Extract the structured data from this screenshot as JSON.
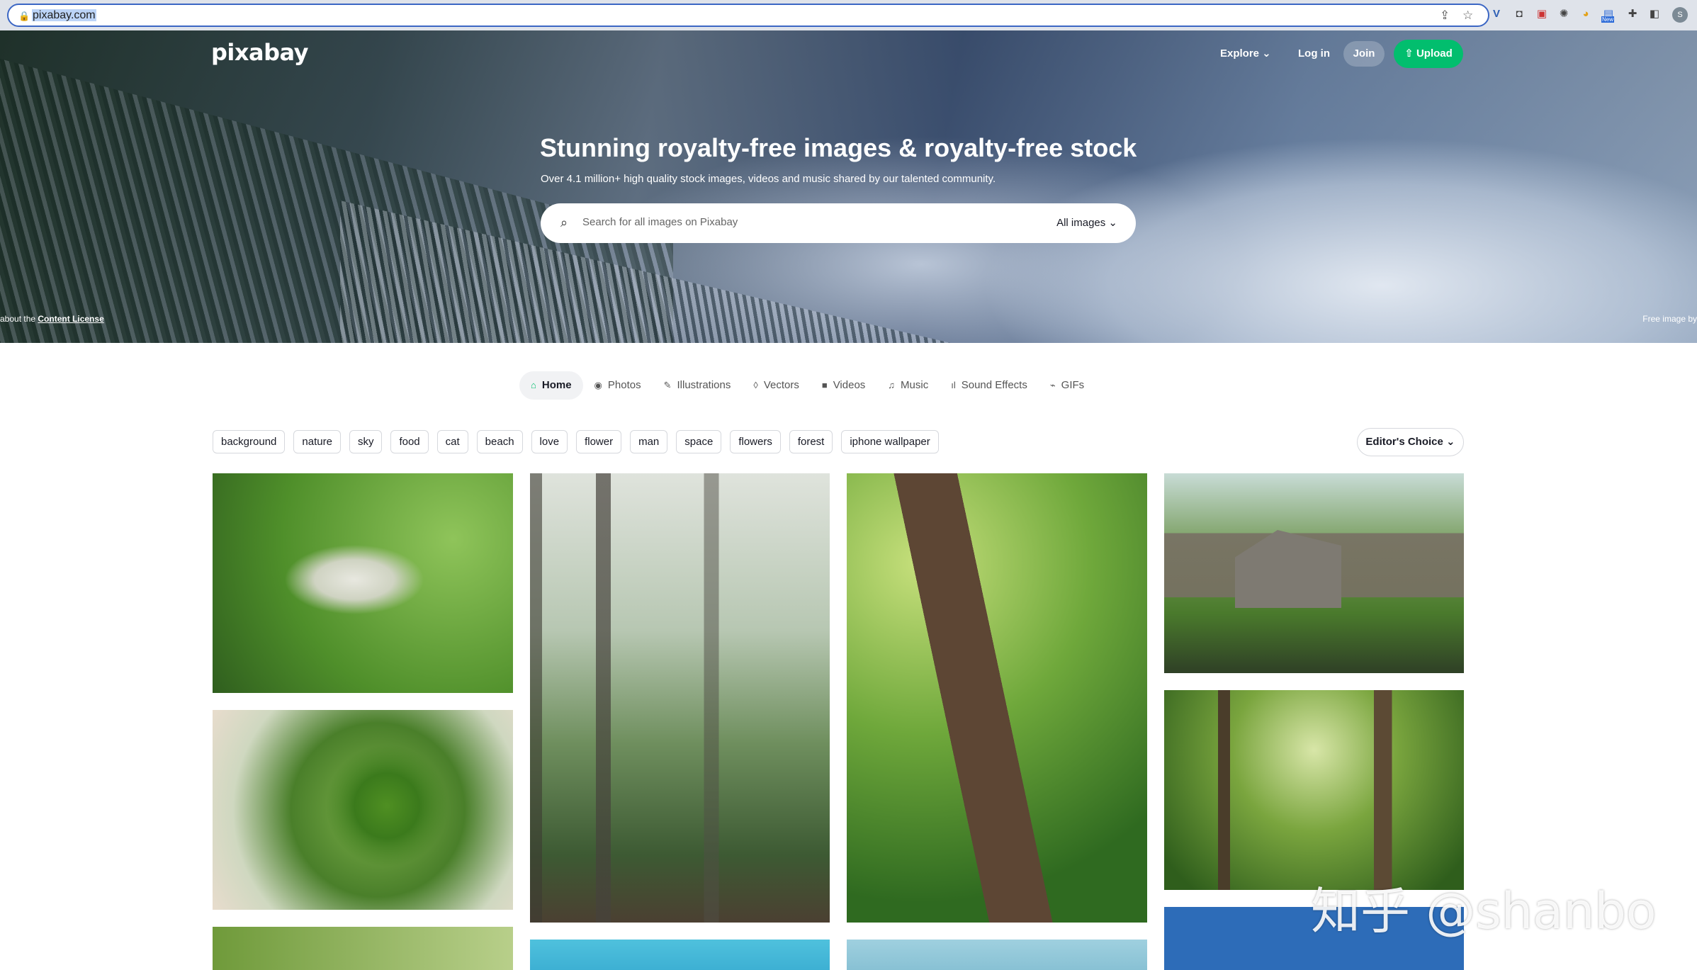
{
  "browser": {
    "url_text": "pixabay.com",
    "extensions": [
      "share-icon",
      "star-icon",
      "v-extension-icon",
      "camera-icon",
      "pdf-icon",
      "settings-icon",
      "chrome-icon",
      "new-extension-icon",
      "puzzle-icon",
      "sidepanel-icon"
    ],
    "extension_badge": "New",
    "profile_initial": "S"
  },
  "header": {
    "logo": "pixabay",
    "explore": "Explore ⌄",
    "login": "Log in",
    "join": "Join",
    "upload": "Upload"
  },
  "hero": {
    "title": "Stunning royalty-free images & royalty-free stock",
    "subtitle": "Over 4.1 million+ high quality stock images, videos and music shared by our talented community.",
    "search_placeholder": "Search for all images on Pixabay",
    "search_scope": "All images ⌄",
    "license_prefix": "about the ",
    "license_link": "Content License",
    "credit": "Free image by "
  },
  "tabs": [
    {
      "label": "Home",
      "icon": "⌂",
      "active": true
    },
    {
      "label": "Photos",
      "icon": "◉"
    },
    {
      "label": "Illustrations",
      "icon": "✎"
    },
    {
      "label": "Vectors",
      "icon": "◊"
    },
    {
      "label": "Videos",
      "icon": "■"
    },
    {
      "label": "Music",
      "icon": "♫"
    },
    {
      "label": "Sound Effects",
      "icon": "ıl"
    },
    {
      "label": "GIFs",
      "icon": "⌁"
    }
  ],
  "tags": [
    "background",
    "nature",
    "sky",
    "food",
    "cat",
    "beach",
    "love",
    "flower",
    "man",
    "space",
    "flowers",
    "forest",
    "iphone wallpaper"
  ],
  "sort": "Editor's Choice ⌄",
  "watermark": "知乎 @shanbo",
  "colors": {
    "accent": "#02be6e",
    "text": "#191b26"
  }
}
